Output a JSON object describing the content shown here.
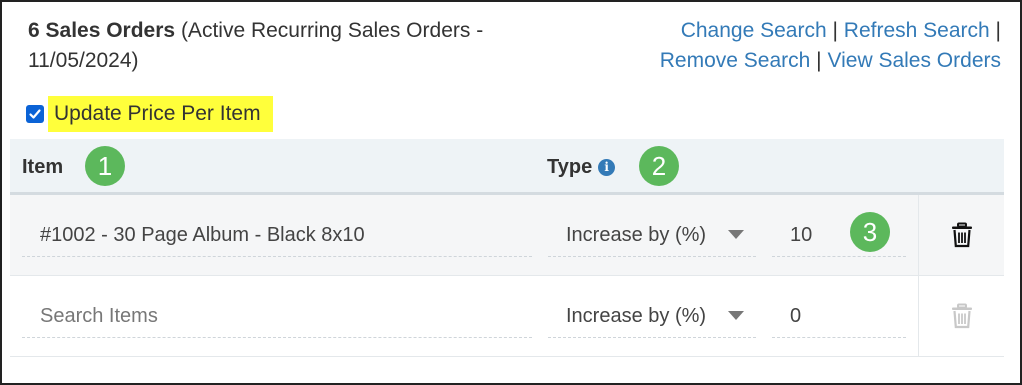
{
  "header": {
    "count_label": "6 Sales Orders",
    "description": "(Active Recurring Sales Orders - 11/05/2024)"
  },
  "links": {
    "change_search": "Change Search",
    "refresh_search": "Refresh Search",
    "remove_search": "Remove Search",
    "view_sales_orders": "View Sales Orders",
    "separator": "|"
  },
  "update_price": {
    "checked": true,
    "label": "Update Price Per Item"
  },
  "table": {
    "columns": {
      "item": "Item",
      "type": "Type"
    },
    "rows": [
      {
        "item": "#1002 - 30 Page Album - Black 8x10",
        "type": "Increase by (%)",
        "value": "10",
        "trash_enabled": true
      },
      {
        "item_placeholder": "Search Items",
        "type": "Increase by (%)",
        "value": "0",
        "trash_enabled": false
      }
    ]
  },
  "badges": [
    "1",
    "2",
    "3"
  ],
  "colors": {
    "link": "#337ab7",
    "highlight": "#ffff3b",
    "badge": "#5cb85c",
    "checkbox": "#0b63d6"
  },
  "icons": [
    "checkbox-checked-icon",
    "info-icon",
    "dropdown-arrow-icon",
    "trash-icon"
  ]
}
